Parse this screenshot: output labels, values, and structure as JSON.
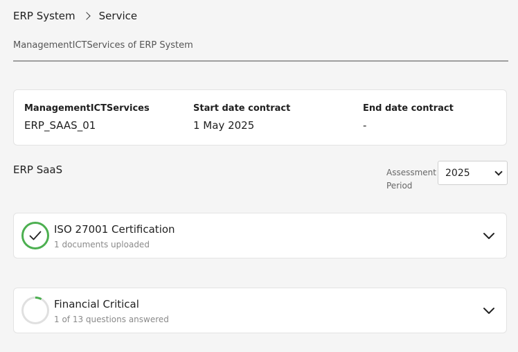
{
  "breadcrumb": {
    "root": "ERP System",
    "current": "Service"
  },
  "subtitle": "ManagementICTServices of ERP System",
  "info": {
    "col1": {
      "label": "ManagementICTServices",
      "value": "ERP_SAAS_01"
    },
    "col2": {
      "label": "Start date contract",
      "value": "1 May 2025"
    },
    "col3": {
      "label": "End date contract",
      "value": "-"
    }
  },
  "section": {
    "title": "ERP SaaS",
    "period_label": "Assessment Period",
    "period_value": "2025"
  },
  "assessments": [
    {
      "title": "ISO 27001 Certification",
      "meta": "1 documents uploaded",
      "status": "complete"
    },
    {
      "title": "Financial Critical",
      "meta": "1 of 13 questions answered",
      "status": "in-progress",
      "progress": 0.077
    }
  ],
  "colors": {
    "success": "#4caf50",
    "track": "#e0e0e0",
    "divider": "#9e9e9e"
  },
  "icons": {
    "breadcrumb_separator": "chevron-right-icon",
    "select_arrow": "chevron-down-icon",
    "complete": "check-circle-icon",
    "progress": "progress-ring-icon",
    "expand": "chevron-down-icon"
  }
}
